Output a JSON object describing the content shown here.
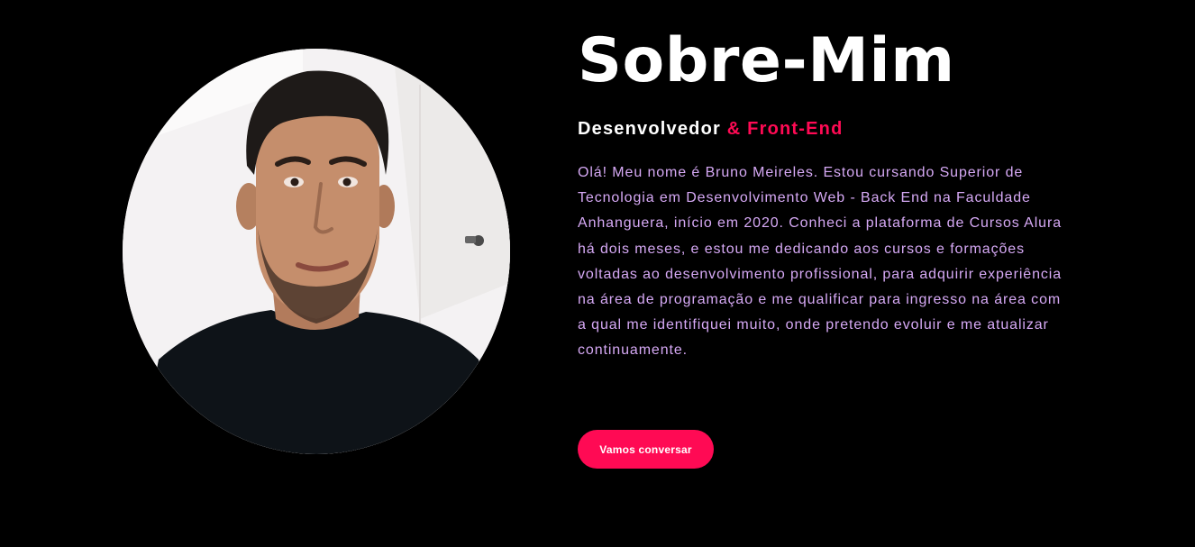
{
  "about": {
    "title": "Sobre-Mim",
    "subtitle_role": "Desenvolvedor",
    "subtitle_accent": "& Front-End",
    "bio": "Olá! Meu nome é Bruno Meireles. Estou cursando Superior de Tecnologia em Desenvolvimento Web - Back End na Faculdade Anhanguera, início em 2020. Conheci a plataforma de Cursos Alura há dois meses, e estou me dedicando aos cursos e formações voltadas ao desenvolvimento profissional, para adquirir experiência na área de programação e me qualificar para ingresso na área com a qual me identifiquei muito, onde pretendo evoluir e me atualizar continuamente.",
    "cta_label": "Vamos conversar"
  },
  "colors": {
    "background": "#000000",
    "accent": "#ff0a54",
    "bio_text": "#d6a9f5",
    "title": "#ffffff"
  },
  "portrait": {
    "icon": "profile-photo"
  }
}
